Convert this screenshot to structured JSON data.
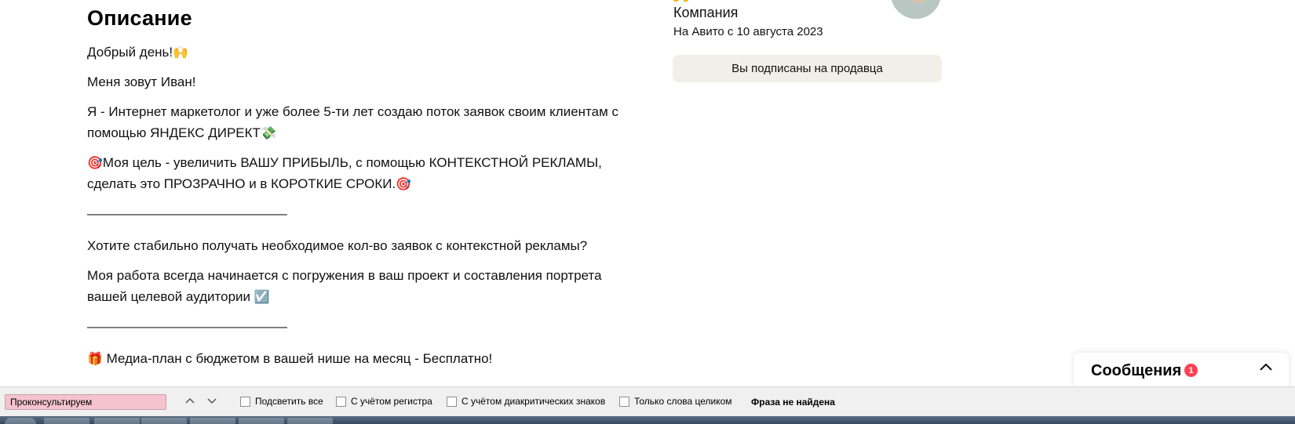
{
  "description": {
    "heading": "Описание",
    "paragraphs": [
      {
        "text": "Добрый день!",
        "emoji": "🙌"
      },
      {
        "text": "Меня зовут Иван!"
      },
      {
        "text": "Я - Интернет маркетолог и уже более 5-ти лет создаю поток заявок своим клиентам с помощью ЯНДЕКС ДИРЕКТ",
        "emoji": "💸"
      },
      {
        "prefix_emoji": "🎯",
        "text": "Моя цель - увеличить ВАШУ ПРИБЫЛЬ, с помощью КОНТЕКСТНОЙ РЕКЛАМЫ, сделать это ПРОЗРАЧНО и в КОРОТКИЕ СРОКИ.",
        "emoji": "🎯"
      },
      {
        "text": "———————————————"
      },
      {
        "text": "Хотите стабильно получать необходимое кол-во заявок с контекстной рекламы?"
      },
      {
        "text": "Моя работа всегда начинается с погружения в ваш проект и составления портрета вашей целевой аудитории",
        "emoji": "☑️"
      },
      {
        "text": "———————————————"
      },
      {
        "prefix_emoji": "🎁",
        "text": " Медиа-план с бюджетом в вашей нише на месяц - Бесплатно!"
      }
    ]
  },
  "seller": {
    "kind": "Компания",
    "since": "На Авито с 10 августа 2023",
    "subscribe_label": "Вы подписаны на продавца"
  },
  "messages": {
    "title": "Сообщения",
    "badge": "1",
    "chevron_icon": "chevron-up-icon"
  },
  "findbar": {
    "query": "Проконсультируем",
    "options": [
      "Подсветить все",
      "С учётом регистра",
      "С учётом диакритических знаков",
      "Только слова целиком"
    ],
    "status": "Фраза не найдена"
  },
  "colors": {
    "subscribe_bg": "#f2efe8",
    "badge": "#ff4053",
    "find_field_bg": "#f4c3cd"
  }
}
